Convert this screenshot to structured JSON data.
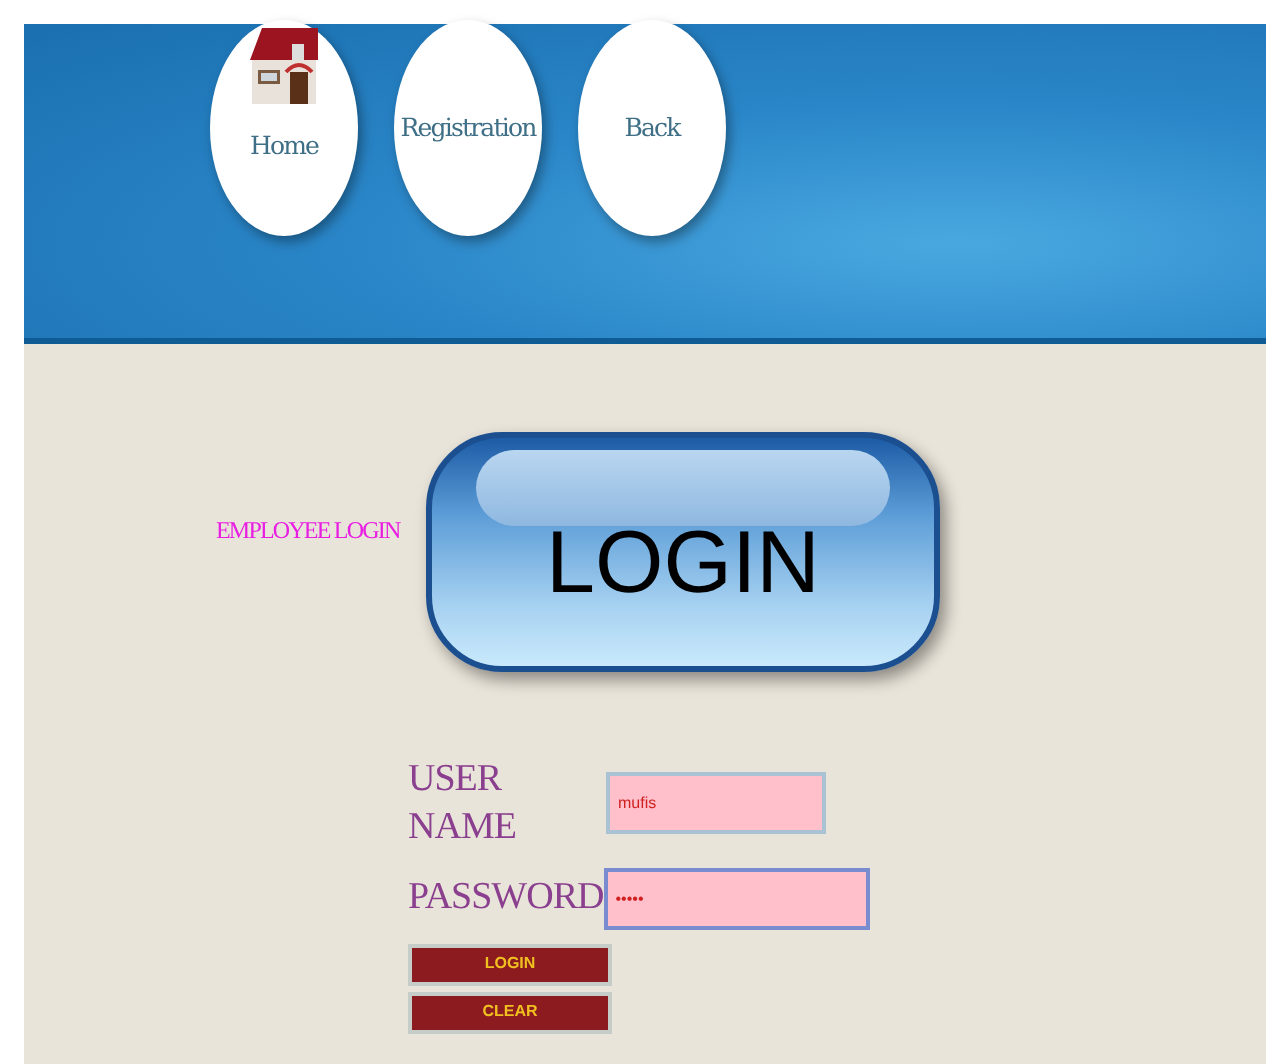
{
  "nav": [
    {
      "label": "Home",
      "kind": "icon-link"
    },
    {
      "label": "Registration",
      "kind": "text-link"
    },
    {
      "label": "Back",
      "kind": "text-link"
    }
  ],
  "heading": "EMPLOYEE LOGIN",
  "banner": "LOGIN",
  "form": {
    "fields": [
      {
        "label": "USER NAME",
        "value": "mufis",
        "focused": false
      },
      {
        "label": "PASSWORD",
        "value": "•••••",
        "focused": true
      }
    ],
    "buttons": [
      "LOGIN",
      "CLEAR"
    ]
  }
}
